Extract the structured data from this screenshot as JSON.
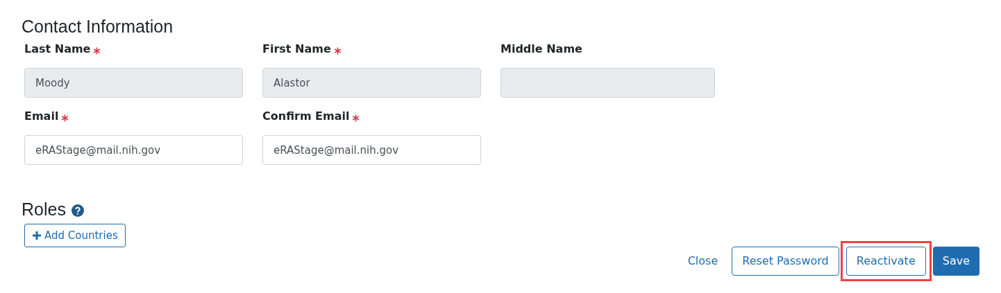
{
  "contact": {
    "title": "Contact Information",
    "fields": [
      {
        "label": "Last Name",
        "required": true,
        "value": "Moody",
        "disabled": true
      },
      {
        "label": "First Name",
        "required": true,
        "value": "Alastor",
        "disabled": true
      },
      {
        "label": "Middle Name",
        "required": false,
        "disabled": true
      },
      {
        "label": "Email",
        "required": true,
        "value": "eRAStage@mail.nih.gov",
        "disabled": false
      },
      {
        "label": "Confirm Email",
        "required": true,
        "value": "eRAStage@mail.nih.gov",
        "disabled": false
      }
    ]
  },
  "roles": {
    "title": "Roles",
    "add_button": "Add Countries"
  },
  "actions": [
    {
      "label": "Close",
      "kind": "link",
      "highlighted": false
    },
    {
      "label": "Reset Password",
      "kind": "outline",
      "highlighted": false
    },
    {
      "label": "Reactivate",
      "kind": "outline",
      "highlighted": true
    },
    {
      "label": "Save",
      "kind": "primary",
      "highlighted": false
    }
  ]
}
